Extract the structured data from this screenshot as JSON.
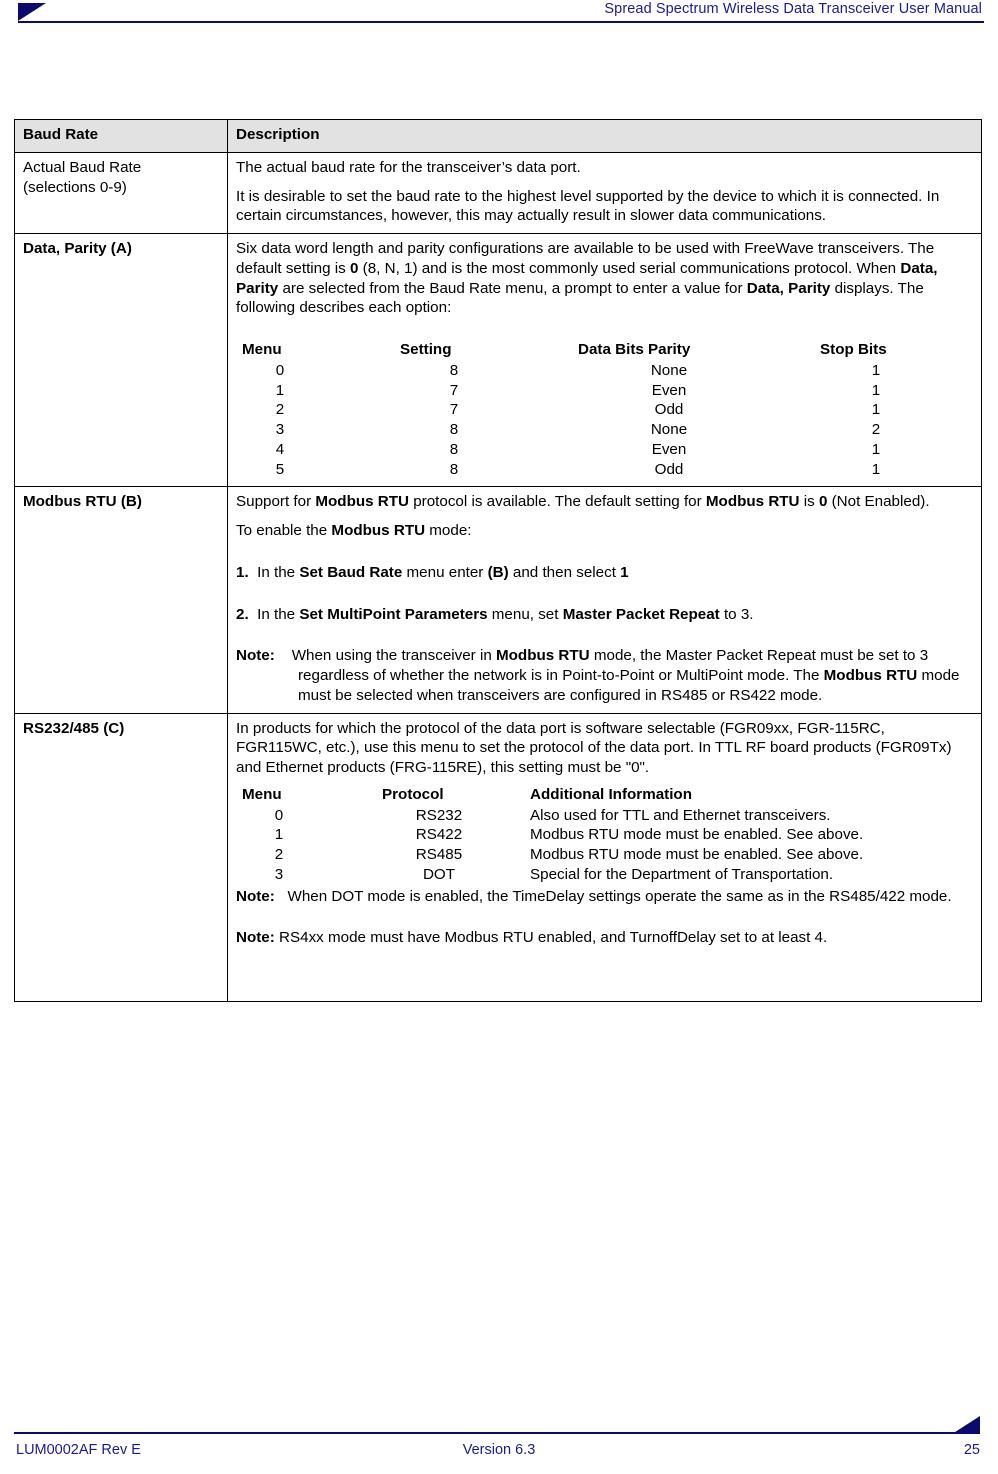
{
  "header": {
    "title": "Spread Spectrum Wireless Data Transceiver User Manual",
    "accent_color": "#0b0b6e",
    "text_color": "#1b1b8f"
  },
  "table": {
    "columns": [
      "Baud Rate",
      "Description"
    ],
    "header_bg": "#e2e2e2",
    "rows": [
      {
        "label": "Actual Baud Rate",
        "label_second_line": "(selections 0-9)",
        "label_bold": false,
        "paragraphs": [
          "The actual baud rate for the transceiver’s data port.",
          "It is desirable to set the baud rate to the highest level supported by the device to which it is connected.  In certain circumstances, however, this may actually result in slower data communications."
        ]
      },
      {
        "label": "Data, Parity (A)",
        "label_bold": true,
        "intro": {
          "p1a": "Six data word length and parity configurations are available to be used with FreeWave transceivers. The default setting is ",
          "b1": "0",
          "p1b": " (8, N, 1) and is the most commonly used serial communications protocol. When ",
          "b2": "Data, Parity",
          "p1c": " are selected from the Baud Rate menu, a prompt to enter a value for ",
          "b3": "Data, Parity",
          "p1d": " displays. The following describes each option:"
        },
        "parity_table": {
          "headers": [
            "Menu",
            "Setting",
            "Data Bits Parity",
            "Stop Bits"
          ],
          "rows": [
            [
              "0",
              "8",
              "None",
              "1"
            ],
            [
              "1",
              "7",
              "Even",
              "1"
            ],
            [
              "2",
              "7",
              "Odd",
              "1"
            ],
            [
              "3",
              "8",
              "None",
              "2"
            ],
            [
              "4",
              "8",
              "Even",
              "1"
            ],
            [
              "5",
              "8",
              "Odd",
              "1"
            ]
          ]
        }
      },
      {
        "label": "Modbus RTU (B)",
        "label_bold": true,
        "p1": {
          "a": "Support for ",
          "b1": "Modbus RTU",
          "b": " protocol is available. The default setting for ",
          "b2": "Modbus RTU",
          "c": " is ",
          "b3": "0",
          "d": " (Not Enabled)."
        },
        "p2": {
          "a": "To enable the ",
          "b1": "Modbus RTU",
          "b": " mode:"
        },
        "step1": {
          "num": "1.",
          "a": "In the ",
          "b1": "Set Baud Rate",
          "b": " menu enter ",
          "b2": "(B)",
          "c": " and then select ",
          "b3": "1"
        },
        "step2": {
          "num": "2.",
          "a": "In the ",
          "b1": "Set MultiPoint Parameters",
          "b": " menu, set ",
          "b2": "Master Packet Repeat",
          "c": " to 3."
        },
        "note": {
          "label": "Note:",
          "a": "When using the transceiver in ",
          "b1": "Modbus RTU",
          "b": " mode, the Master Packet Repeat must be set to 3 regardless of whether the network is in Point-to-Point or MultiPoint mode. The ",
          "b2": "Modbus RTU",
          "c": " mode must be selected when transceivers are configured in RS485 or RS422 mode."
        }
      },
      {
        "label": "RS232/485 (C)",
        "label_bold": true,
        "intro": "In products for which the protocol of the data port is software selectable (FGR09xx, FGR-115RC, FGR115WC, etc.), use this menu to set the protocol of the data port. In TTL RF board products (FGR09Tx) and Ethernet products (FRG-115RE), this setting must be \"0\".",
        "protocol_table": {
          "headers": [
            "Menu",
            "Protocol",
            "Additional Information"
          ],
          "rows": [
            [
              "0",
              "RS232",
              "Also used for TTL and Ethernet transceivers."
            ],
            [
              "1",
              "RS422",
              "Modbus RTU mode must be enabled. See above."
            ],
            [
              "2",
              "RS485",
              "Modbus RTU mode must be enabled. See above."
            ],
            [
              "3",
              "DOT",
              "Special for the Department of Transportation."
            ]
          ]
        },
        "note1": {
          "label": "Note:",
          "text": "When DOT mode is enabled, the TimeDelay settings operate the same as in the RS485/422 mode."
        },
        "note2": {
          "label": "Note:",
          "text": "RS4xx mode must have Modbus RTU enabled, and TurnoffDelay set to at least 4."
        }
      }
    ]
  },
  "footer": {
    "left": "LUM0002AF Rev E",
    "center": "Version 6.3",
    "right": "25"
  }
}
